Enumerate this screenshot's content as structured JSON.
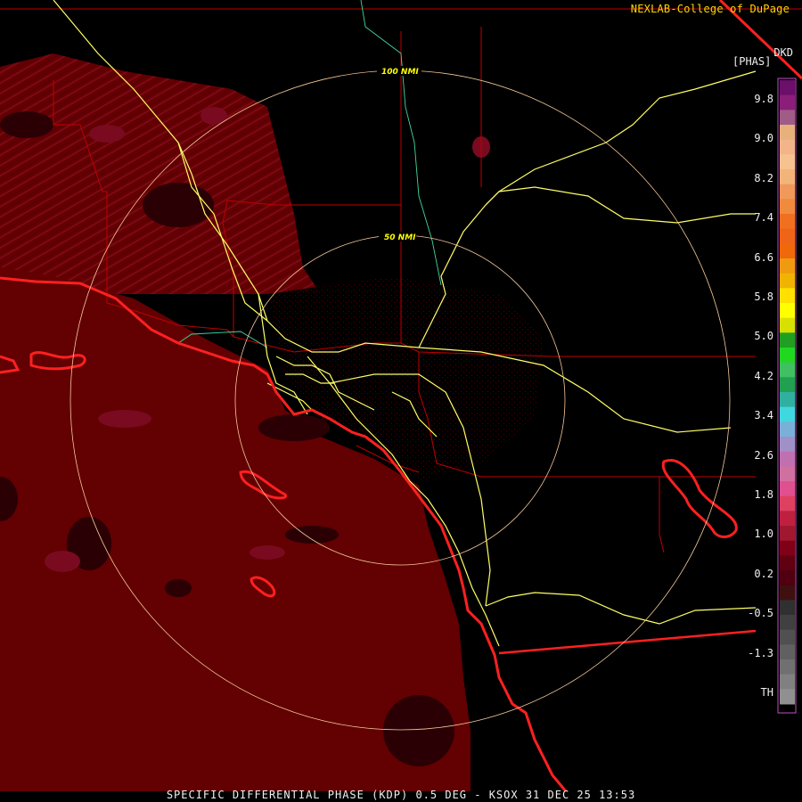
{
  "credit": "NEXLAB-College of DuPage",
  "product_code": "DKD",
  "unit": "[PHAS]",
  "caption": "SPECIFIC DIFFERENTIAL PHASE (KDP) 0.5 DEG - KSOX 31 DEC 25 13:53",
  "range_rings": [
    "50 NMI",
    "100 NMI"
  ],
  "colorbar": {
    "ticks": [
      "9.8",
      "9.0",
      "8.2",
      "7.4",
      "6.6",
      "5.8",
      "5.0",
      "4.2",
      "3.4",
      "2.6",
      "1.8",
      "1.0",
      "0.2",
      "-0.5",
      "-1.3",
      "TH"
    ],
    "colors": [
      "#6b0f6b",
      "#8a1e78",
      "#a05c86",
      "#e8b07a",
      "#f4b48a",
      "#f6c28f",
      "#f3b47a",
      "#f0995a",
      "#f08a3c",
      "#f07020",
      "#f06418",
      "#f0680a",
      "#f09a10",
      "#f0b400",
      "#ffe000",
      "#ffff00",
      "#d8e000",
      "#20a020",
      "#20d820",
      "#40c060",
      "#20a050",
      "#30b0a0",
      "#40d8e0",
      "#7ab0d8",
      "#a090c8",
      "#c070b0",
      "#d070a0",
      "#e05090",
      "#e04060",
      "#c02040",
      "#a01830",
      "#800018",
      "#600010",
      "#500010",
      "#401010",
      "#303030",
      "#404040",
      "#505050",
      "#606060",
      "#707070",
      "#808080",
      "#909090"
    ]
  },
  "colors": {
    "echo": "#660000",
    "echo_dark": "#3a0004",
    "coast": "#ff2020",
    "county": "#c00000",
    "highway": "#ffff66",
    "river": "#44d6a0",
    "ring": "#f7c99a"
  }
}
